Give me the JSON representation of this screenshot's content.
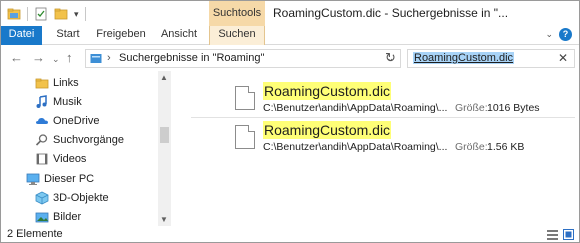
{
  "titlebar": {
    "context_tab": "Suchtools",
    "title": "RoamingCustom.dic - Suchergebnisse in \"..."
  },
  "ribbon": {
    "tabs": [
      "Datei",
      "Start",
      "Freigeben",
      "Ansicht",
      "Suchen"
    ],
    "active_context": "Suchen"
  },
  "address": {
    "breadcrumb": "Suchergebnisse in \"Roaming\"",
    "search_query": "RoamingCustom.dic"
  },
  "sidebar": {
    "items": [
      {
        "label": "Links",
        "icon": "links-folder-icon"
      },
      {
        "label": "Musik",
        "icon": "music-icon"
      },
      {
        "label": "OneDrive",
        "icon": "onedrive-cloud-icon"
      },
      {
        "label": "Suchvorgänge",
        "icon": "search-icon"
      },
      {
        "label": "Videos",
        "icon": "video-icon"
      },
      {
        "label": "Dieser PC",
        "icon": "computer-icon"
      },
      {
        "label": "3D-Objekte",
        "icon": "3d-objects-icon"
      },
      {
        "label": "Bilder",
        "icon": "pictures-icon"
      }
    ]
  },
  "results": [
    {
      "name": "RoamingCustom.dic",
      "path": "C:\\Benutzer\\andih\\AppData\\Roaming\\...",
      "size_label": "Größe:",
      "size": "1016 Bytes"
    },
    {
      "name": "RoamingCustom.dic",
      "path": "C:\\Benutzer\\andih\\AppData\\Roaming\\...",
      "size_label": "Größe:",
      "size": "1.56 KB"
    }
  ],
  "status": {
    "count": "2 Elemente"
  },
  "colors": {
    "accent": "#1979ca",
    "context_tab": "#f6d9a8",
    "highlight": "#ffff77",
    "selection": "#a8d3f7"
  }
}
